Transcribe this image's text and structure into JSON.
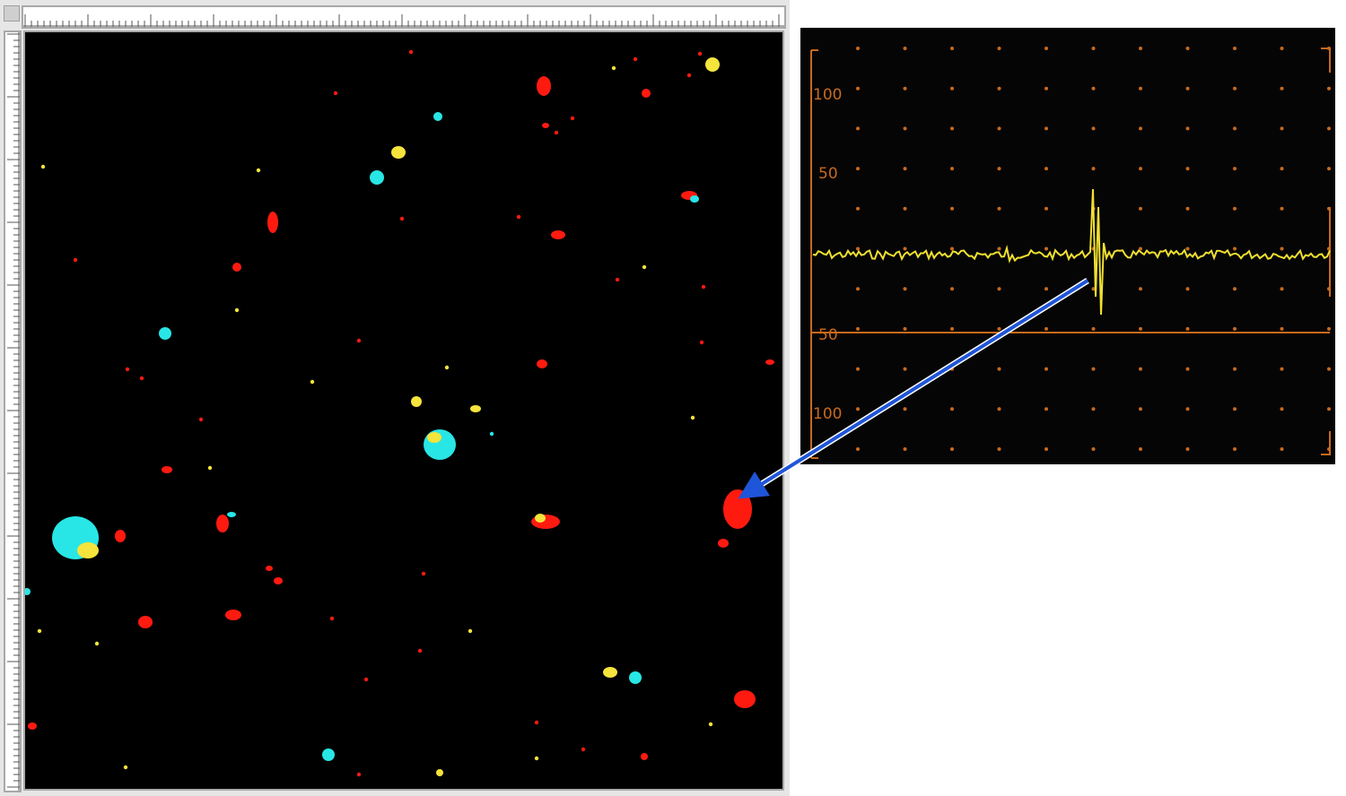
{
  "ascan": {
    "y_tick_labels": [
      "100",
      "50",
      "50",
      "100"
    ],
    "colors": {
      "grid": "#c86a1e",
      "trace": "#f0e030",
      "background": "#050505"
    }
  },
  "cscan": {
    "palette": {
      "red": "#ff1a10",
      "cyan": "#28e6e6",
      "yellow": "#f4e43c",
      "orange": "#ff8c1a",
      "background": "#000000"
    }
  },
  "annotation": {
    "arrow_color": "#1f55d8"
  }
}
